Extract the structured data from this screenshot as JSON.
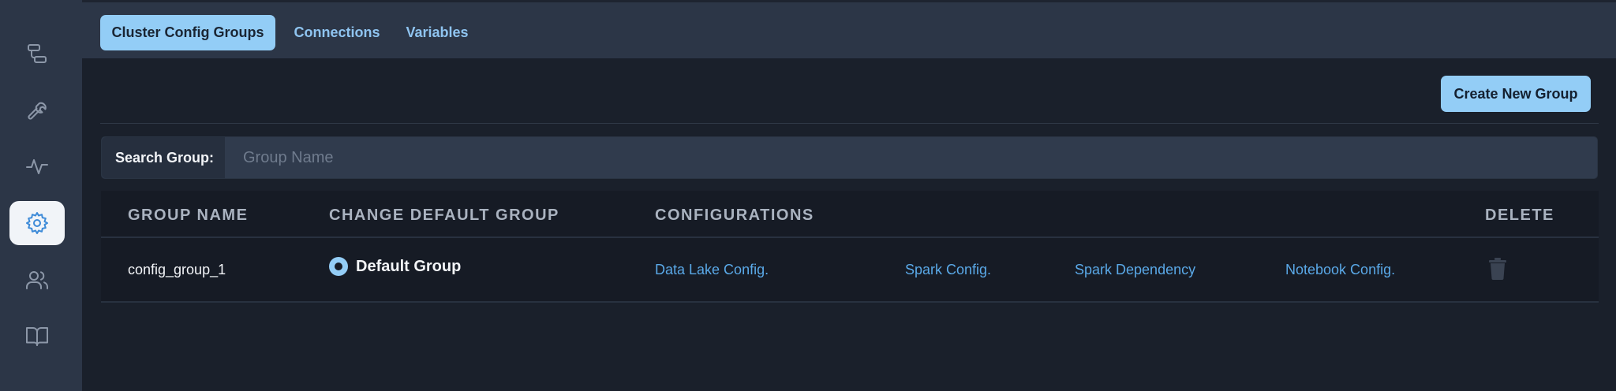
{
  "sidebar": {
    "items": [
      {
        "icon": "flow-icon",
        "active": false
      },
      {
        "icon": "wrench-icon",
        "active": false
      },
      {
        "icon": "activity-icon",
        "active": false
      },
      {
        "icon": "gear-icon",
        "active": true
      },
      {
        "icon": "users-icon",
        "active": false
      },
      {
        "icon": "book-icon",
        "active": false
      }
    ]
  },
  "tabs": [
    {
      "label": "Cluster Config Groups",
      "active": true
    },
    {
      "label": "Connections",
      "active": false
    },
    {
      "label": "Variables",
      "active": false
    }
  ],
  "toolbar": {
    "create_label": "Create New Group"
  },
  "search": {
    "label": "Search Group:",
    "placeholder": "Group Name",
    "value": ""
  },
  "table": {
    "headers": [
      "GROUP NAME",
      "CHANGE DEFAULT GROUP",
      "CONFIGURATIONS",
      "DELETE"
    ],
    "rows": [
      {
        "group_name": "config_group_1",
        "default_label": "Default Group",
        "is_default": true,
        "configs": [
          "Data Lake Config.",
          "Spark Config.",
          "Spark Dependency",
          "Notebook Config."
        ],
        "delete_icon": "trash-icon"
      }
    ]
  },
  "colors": {
    "accent": "#93cdf6",
    "link": "#5aa9e8",
    "background": "#1a202b",
    "sidebar": "#2c3647"
  }
}
